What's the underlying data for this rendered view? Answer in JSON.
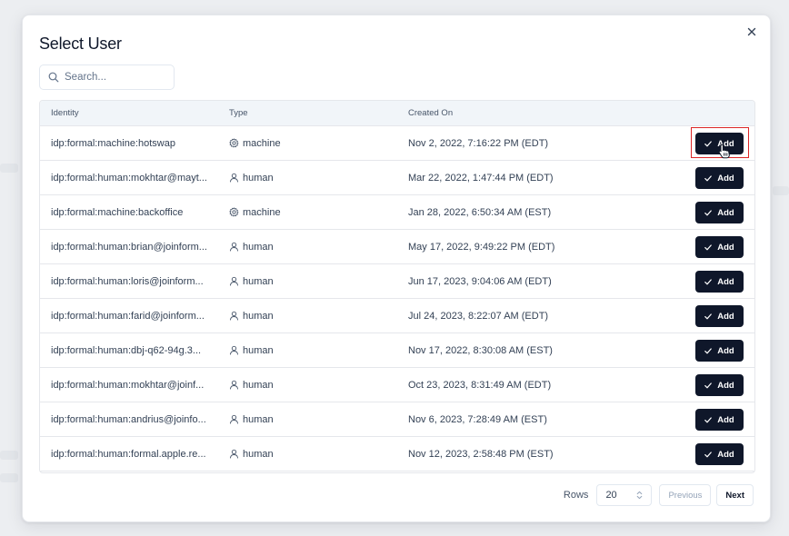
{
  "dialog": {
    "title": "Select User",
    "close_icon": "close-icon"
  },
  "search": {
    "placeholder": "Search...",
    "value": "",
    "icon": "search-icon"
  },
  "table": {
    "columns": [
      "Identity",
      "Type",
      "Created On",
      ""
    ],
    "action_label": "Add",
    "action_icon": "check-icon",
    "rows": [
      {
        "identity": "idp:formal:machine:hotswap",
        "type": "machine",
        "created": "Nov 2, 2022, 7:16:22 PM (EDT)"
      },
      {
        "identity": "idp:formal:human:mokhtar@mayt...",
        "type": "human",
        "created": "Mar 22, 2022, 1:47:44 PM (EDT)"
      },
      {
        "identity": "idp:formal:machine:backoffice",
        "type": "machine",
        "created": "Jan 28, 2022, 6:50:34 AM (EST)"
      },
      {
        "identity": "idp:formal:human:brian@joinform...",
        "type": "human",
        "created": "May 17, 2022, 9:49:22 PM (EDT)"
      },
      {
        "identity": "idp:formal:human:loris@joinform...",
        "type": "human",
        "created": "Jun 17, 2023, 9:04:06 AM (EDT)"
      },
      {
        "identity": "idp:formal:human:farid@joinform...",
        "type": "human",
        "created": "Jul 24, 2023, 8:22:07 AM (EDT)"
      },
      {
        "identity": "idp:formal:human:dbj-q62-94g.3...",
        "type": "human",
        "created": "Nov 17, 2022, 8:30:08 AM (EST)"
      },
      {
        "identity": "idp:formal:human:mokhtar@joinf...",
        "type": "human",
        "created": "Oct 23, 2023, 8:31:49 AM (EDT)"
      },
      {
        "identity": "idp:formal:human:andrius@joinfo...",
        "type": "human",
        "created": "Nov 6, 2023, 7:28:49 AM (EST)"
      },
      {
        "identity": "idp:formal:human:formal.apple.re...",
        "type": "human",
        "created": "Nov 12, 2023, 2:58:48 PM (EST)"
      }
    ]
  },
  "pagination": {
    "rows_label": "Rows",
    "rows_value": "20",
    "previous_label": "Previous",
    "next_label": "Next"
  },
  "colors": {
    "primary_button": "#0f172a",
    "highlight": "#dc2626"
  }
}
